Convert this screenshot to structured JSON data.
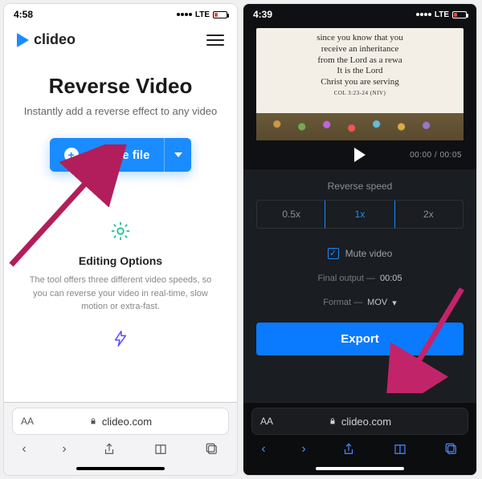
{
  "left": {
    "statusbar": {
      "time": "4:58",
      "carrier": "LTE"
    },
    "brand": "clideo",
    "hero": {
      "title": "Reverse Video",
      "subtitle": "Instantly add a reverse effect to any video"
    },
    "choose_file": {
      "label": "Choose file"
    },
    "editing": {
      "title": "Editing Options",
      "desc": "The tool offers three different video speeds, so you can reverse your video in real-time, slow motion or extra-fast."
    },
    "safari": {
      "font_button": "AA",
      "domain": "clideo.com"
    }
  },
  "right": {
    "statusbar": {
      "time": "4:39",
      "carrier": "LTE"
    },
    "video_text": {
      "l1": "since you know that you",
      "l2": "receive an inheritance",
      "l3": "from the Lord as a rewa",
      "l4": "It is the Lord",
      "l5": "Christ you are serving",
      "ref": "COL 3:23-24 (NIV)"
    },
    "player": {
      "current": "00:00",
      "total": "00:05"
    },
    "panel": {
      "title": "Reverse speed",
      "speeds": [
        "0.5x",
        "1x",
        "2x"
      ],
      "selected_index": 1,
      "mute_label": "Mute video",
      "final_output_label": "Final output —",
      "final_output_value": "00:05",
      "format_label": "Format —",
      "format_value": "MOV",
      "export_label": "Export"
    },
    "safari": {
      "font_button": "AA",
      "domain": "clideo.com"
    }
  }
}
